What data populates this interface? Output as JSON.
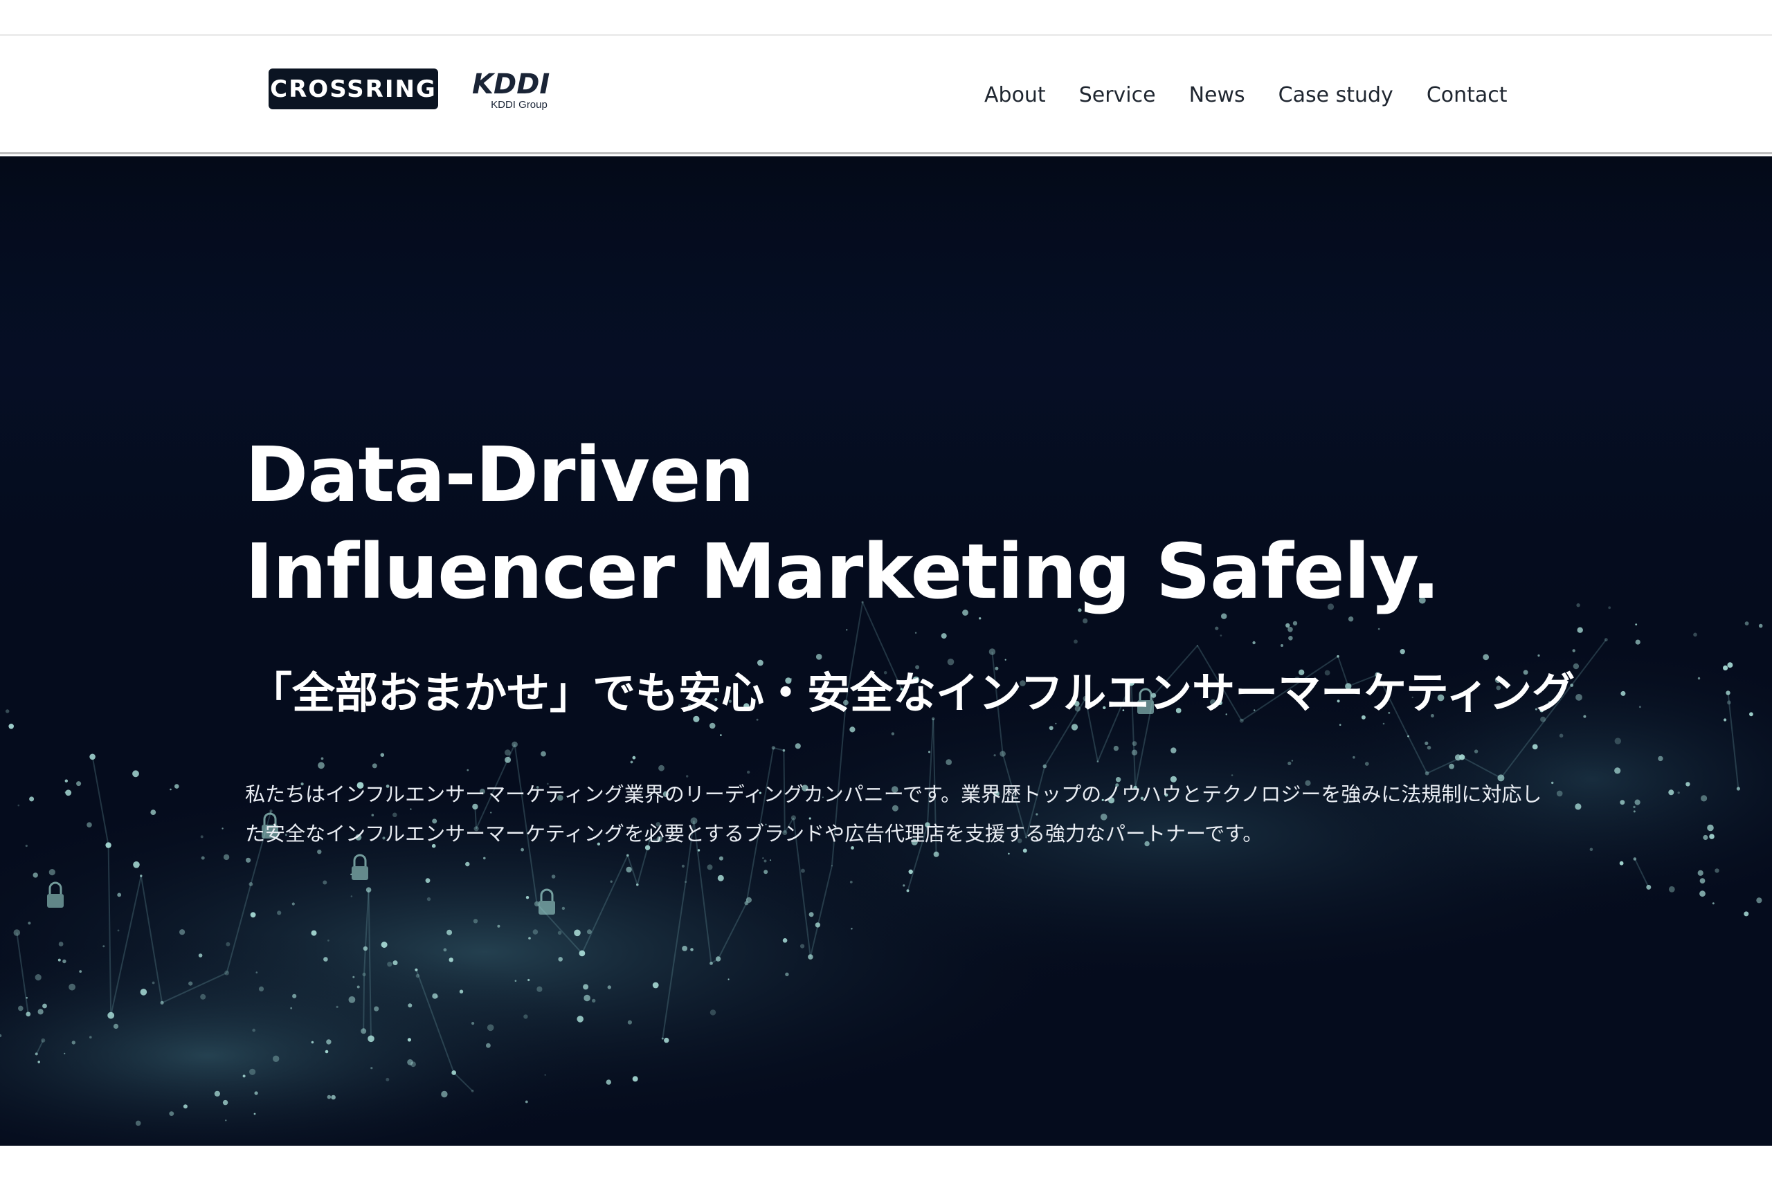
{
  "header": {
    "logo_text": "CROSSRING",
    "partner_logo_text": "KDDI",
    "partner_logo_sub": "KDDI Group",
    "nav": [
      "About",
      "Service",
      "News",
      "Case study",
      "Contact"
    ]
  },
  "hero": {
    "headline_line1": "Data-Driven",
    "headline_line2": "Influencer Marketing Safely.",
    "subhead": "「全部おまかせ」でも安心・安全なインフルエンサーマーケティング",
    "body": "私たちはインフルエンサーマーケティング業界のリーディングカンパニーです。業界歴トップのノウハウとテクノロジーを強みに法規制に対応した安全なインフルエンサーマーケティングを必要とするブランドや広告代理店を支援する強力なパートナーです。"
  },
  "colors": {
    "hero_background": "#050c1d",
    "logo_background": "#0b1422",
    "particle_teal": "#9fd6cf"
  },
  "icons": [
    "lock-icon"
  ]
}
